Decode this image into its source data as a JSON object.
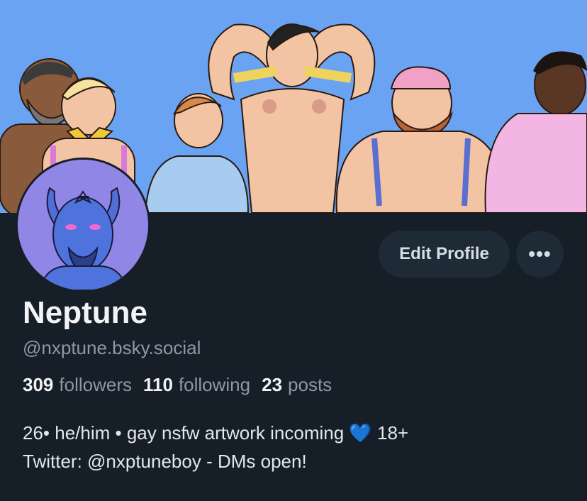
{
  "profile": {
    "display_name": "Neptune",
    "handle": "@nxptune.bsky.social",
    "edit_label": "Edit Profile",
    "more_label": "•••",
    "stats": {
      "followers_count": "309",
      "followers_label": "followers",
      "following_count": "110",
      "following_label": "following",
      "posts_count": "23",
      "posts_label": "posts"
    },
    "bio_line1_text": "26• he/him • gay nsfw artwork incoming ",
    "bio_line1_emoji": "💙",
    "bio_line1_tail": " 18+",
    "bio_line2": "Twitter: @nxptuneboy - DMs open!"
  },
  "colors": {
    "background": "#161e27",
    "banner_sky": "#6aa3f2",
    "avatar_bg": "#8f86e6",
    "button_bg": "#1e2a36",
    "muted_text": "#8d99a6"
  },
  "icons": [
    "ellipsis-icon",
    "blue-heart-emoji"
  ]
}
